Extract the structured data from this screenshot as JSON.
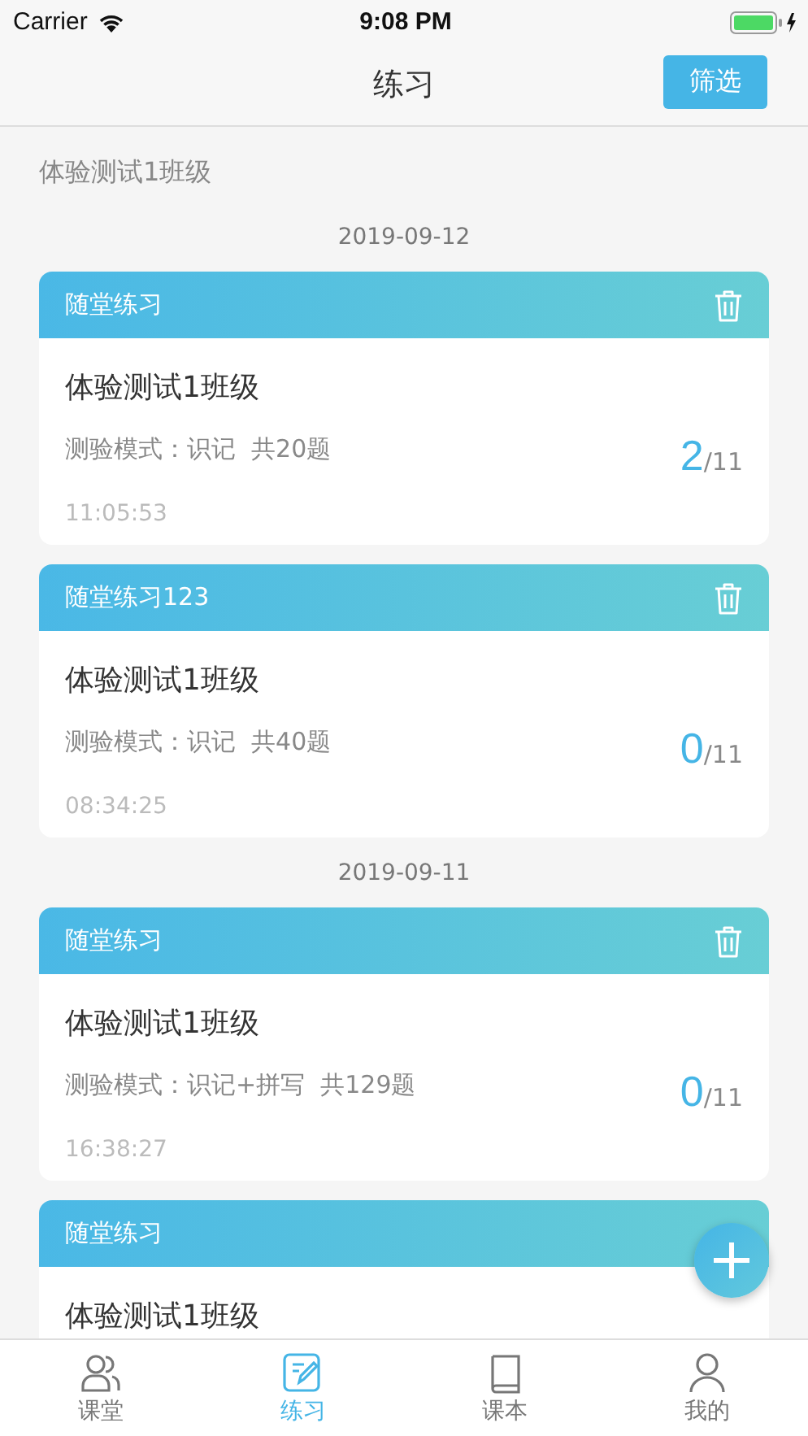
{
  "status_bar": {
    "carrier": "Carrier",
    "time": "9:08 PM"
  },
  "nav": {
    "title": "练习",
    "filter_button": "筛选"
  },
  "class_name": "体验测试1班级",
  "groups": [
    {
      "date": "2019-09-12",
      "cards": [
        {
          "type": "随堂练习",
          "title": "体验测试1班级",
          "mode": "测验模式：识记  共20题",
          "done": "2",
          "total": "/11",
          "time": "11:05:53"
        },
        {
          "type": "随堂练习123",
          "title": "体验测试1班级",
          "mode": "测验模式：识记  共40题",
          "done": "0",
          "total": "/11",
          "time": "08:34:25"
        }
      ]
    },
    {
      "date": "2019-09-11",
      "cards": [
        {
          "type": "随堂练习",
          "title": "体验测试1班级",
          "mode": "测验模式：识记+拼写  共129题",
          "done": "0",
          "total": "/11",
          "time": "16:38:27"
        },
        {
          "type": "随堂练习",
          "title": "体验测试1班级"
        }
      ]
    }
  ],
  "tabs": [
    {
      "label": "课堂",
      "selected": false
    },
    {
      "label": "练习",
      "selected": true
    },
    {
      "label": "课本",
      "selected": false
    },
    {
      "label": "我的",
      "selected": false
    }
  ]
}
